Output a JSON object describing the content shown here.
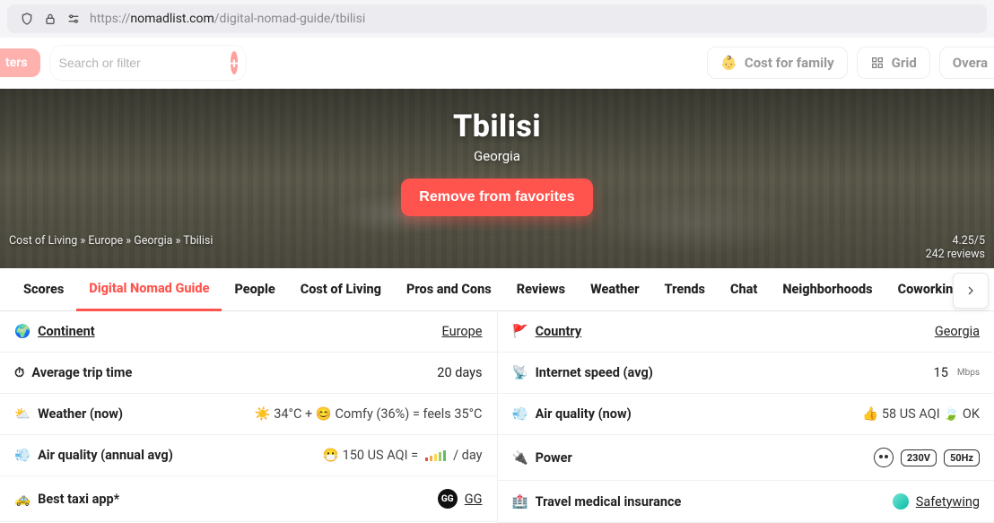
{
  "url": {
    "scheme": "https://",
    "host": "nomadlist.com",
    "path": "/digital-nomad-guide/tbilisi"
  },
  "toolbar": {
    "filters_pill": "ters",
    "search_placeholder": "Search or filter",
    "cost_family": "Cost for family",
    "grid": "Grid",
    "overall": "Overa"
  },
  "hero": {
    "title": "Tbilisi",
    "subtitle": "Georgia",
    "fav_button": "Remove from favorites",
    "breadcrumb": [
      "Cost of Living",
      "Europe",
      "Georgia",
      "Tbilisi"
    ],
    "score": "4.25/5",
    "reviews": "242 reviews"
  },
  "tabs": [
    "Scores",
    "Digital Nomad Guide",
    "People",
    "Cost of Living",
    "Pros and Cons",
    "Reviews",
    "Weather",
    "Trends",
    "Chat",
    "Neighborhoods",
    "Coworking"
  ],
  "active_tab": 1,
  "left": {
    "continent": {
      "label": "Continent",
      "value": "Europe"
    },
    "trip_time": {
      "label": "Average trip time",
      "value": "20 days"
    },
    "weather_now": {
      "label": "Weather (now)",
      "value": "☀️ 34°C + 😊 Comfy (36%) = feels 35°C"
    },
    "aqi_avg": {
      "label": "Air quality (annual avg)",
      "value_pre": "😷 150 US AQI  =",
      "value_post": "/ day"
    },
    "taxi": {
      "label": "Best taxi app*",
      "badge": "GG",
      "value": "GG"
    }
  },
  "right": {
    "country": {
      "label": "Country",
      "value": "Georgia"
    },
    "internet": {
      "label": "Internet speed (avg)",
      "value": "15",
      "unit": "Mbps"
    },
    "aqi_now": {
      "label": "Air quality (now)",
      "value": "👍 58 US AQI 🍃 OK"
    },
    "power": {
      "label": "Power",
      "volt": "230V",
      "hz": "50Hz"
    },
    "insurance": {
      "label": "Travel medical insurance",
      "value": "Safetywing"
    }
  }
}
